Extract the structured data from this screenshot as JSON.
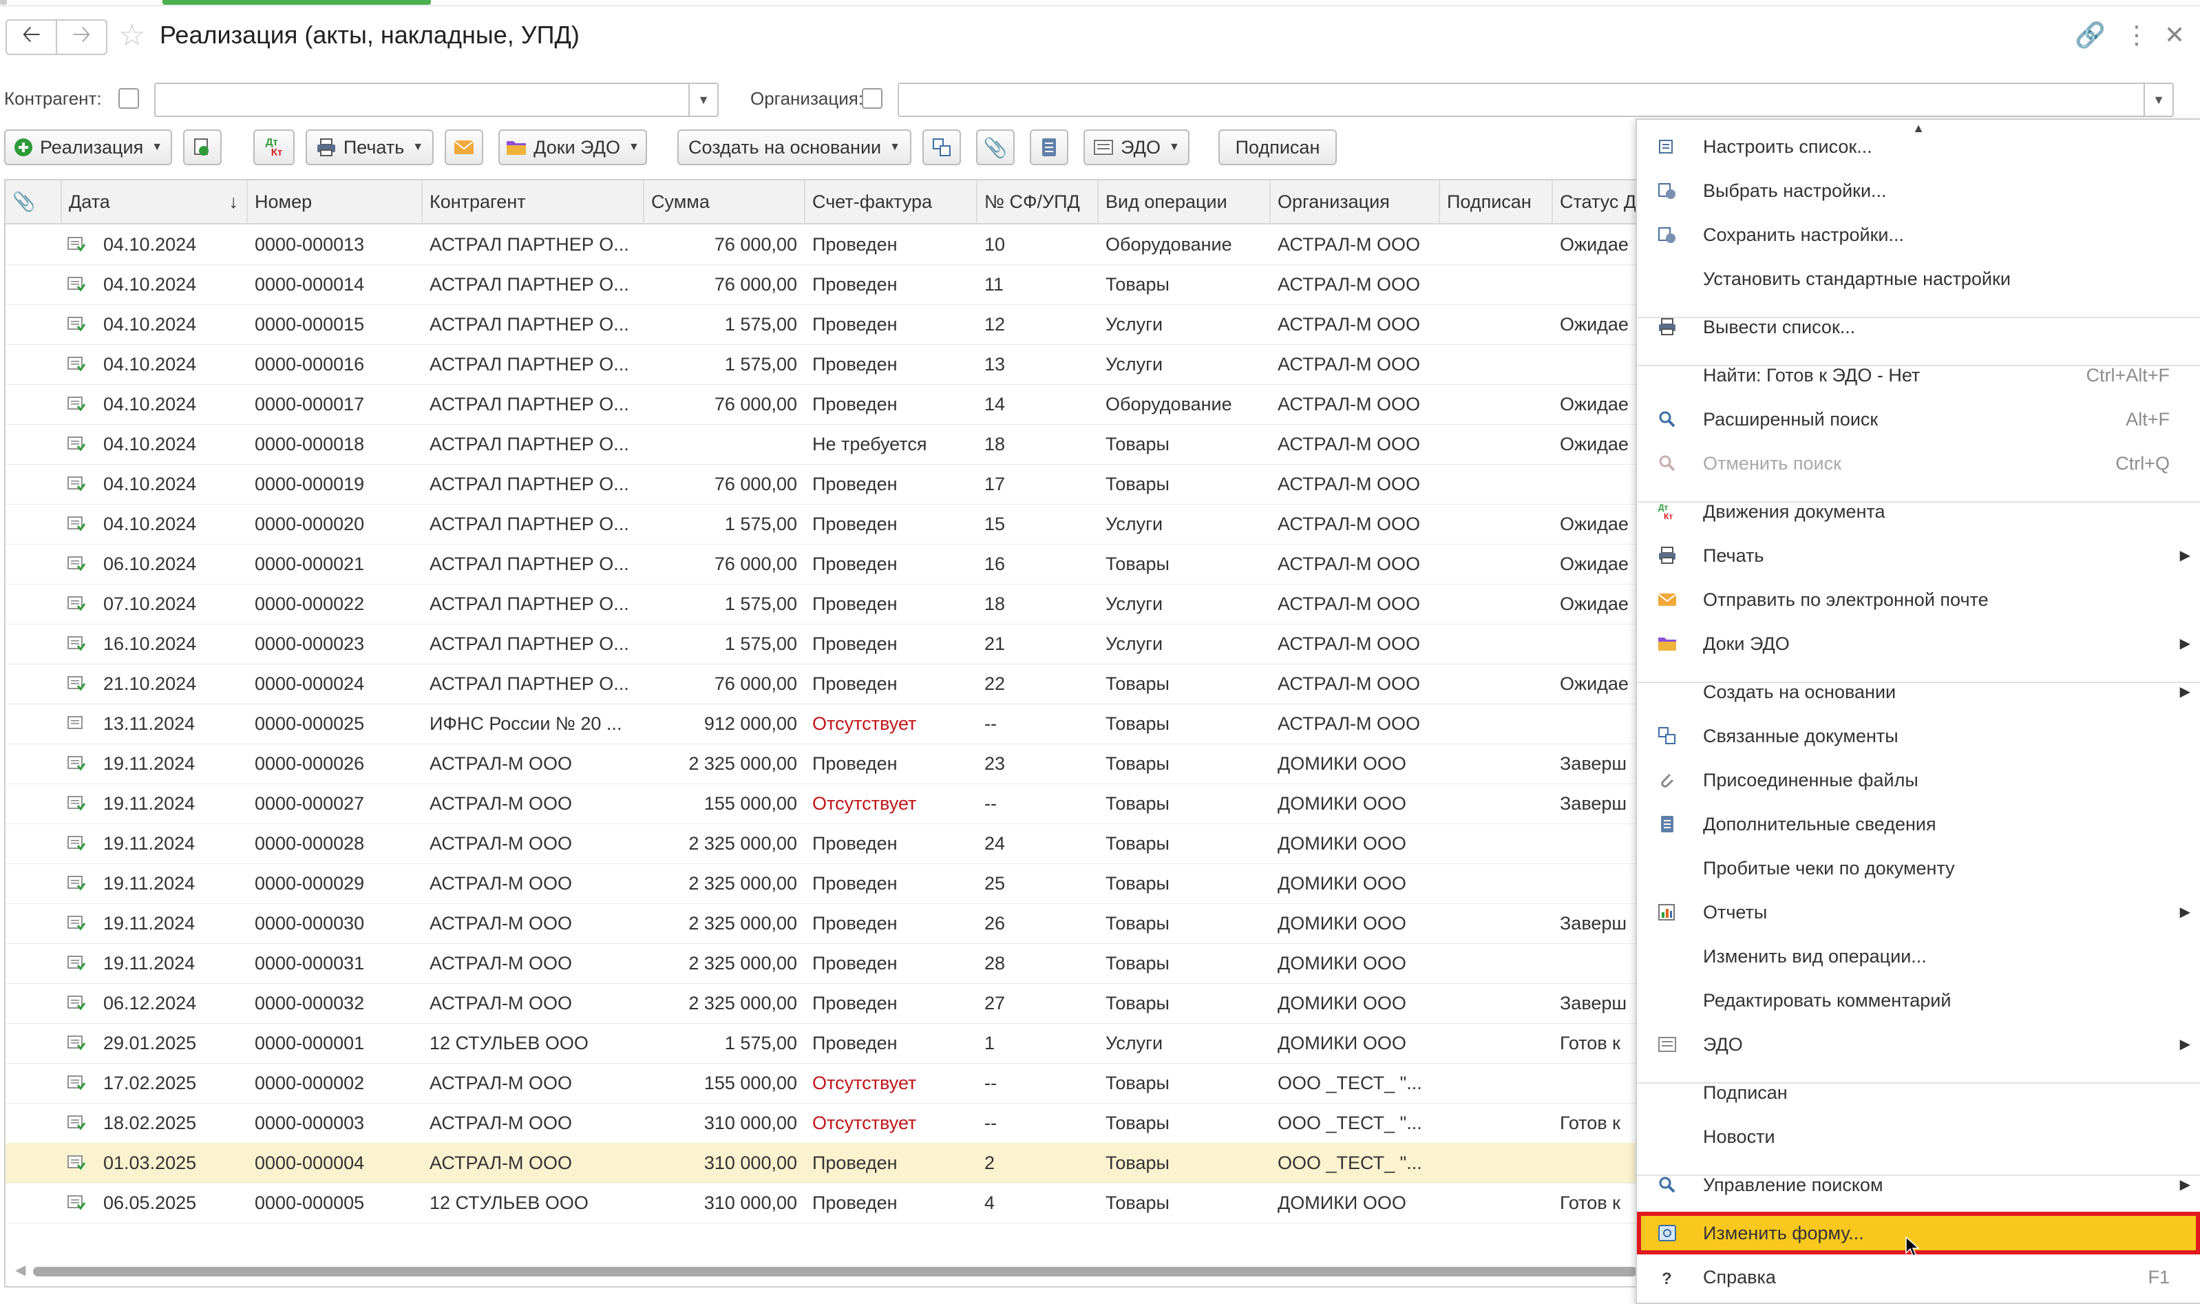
{
  "window": {
    "title": "Реализация (акты, накладные, УПД)"
  },
  "filters": {
    "counterparty_label": "Контрагент:",
    "counterparty_value": "",
    "organization_label": "Организация:",
    "organization_value": ""
  },
  "toolbar": {
    "realization": "Реализация",
    "print": "Печать",
    "edo_docs": "Доки ЭДО",
    "create_based": "Создать на основании",
    "edo": "ЭДО",
    "signed": "Подписан",
    "dtkt_top": "Дт",
    "dtkt_bottom": "Кт"
  },
  "table": {
    "columns": [
      "Дата",
      "Номер",
      "Контрагент",
      "Сумма",
      "Счет-фактура",
      "№ СФ/УПД",
      "Вид операции",
      "Организация",
      "Подписан",
      "Статус Д"
    ],
    "sort_indicator": "↓",
    "rows": [
      {
        "date": "04.10.2024",
        "number": "0000-000013",
        "counterparty": "АСТРАЛ ПАРТНЕР О...",
        "sum": "76 000,00",
        "invoice": "Проведен",
        "sf": "10",
        "operation": "Оборудование",
        "org": "АСТРАЛ-М ООО",
        "signed": "",
        "status": "Ожидае",
        "invoice_missing": false
      },
      {
        "date": "04.10.2024",
        "number": "0000-000014",
        "counterparty": "АСТРАЛ ПАРТНЕР О...",
        "sum": "76 000,00",
        "invoice": "Проведен",
        "sf": "11",
        "operation": "Товары",
        "org": "АСТРАЛ-М ООО",
        "signed": "",
        "status": "",
        "invoice_missing": false
      },
      {
        "date": "04.10.2024",
        "number": "0000-000015",
        "counterparty": "АСТРАЛ ПАРТНЕР О...",
        "sum": "1 575,00",
        "invoice": "Проведен",
        "sf": "12",
        "operation": "Услуги",
        "org": "АСТРАЛ-М ООО",
        "signed": "",
        "status": "Ожидае",
        "invoice_missing": false
      },
      {
        "date": "04.10.2024",
        "number": "0000-000016",
        "counterparty": "АСТРАЛ ПАРТНЕР О...",
        "sum": "1 575,00",
        "invoice": "Проведен",
        "sf": "13",
        "operation": "Услуги",
        "org": "АСТРАЛ-М ООО",
        "signed": "",
        "status": "",
        "invoice_missing": false
      },
      {
        "date": "04.10.2024",
        "number": "0000-000017",
        "counterparty": "АСТРАЛ ПАРТНЕР О...",
        "sum": "76 000,00",
        "invoice": "Проведен",
        "sf": "14",
        "operation": "Оборудование",
        "org": "АСТРАЛ-М ООО",
        "signed": "",
        "status": "Ожидае",
        "invoice_missing": false
      },
      {
        "date": "04.10.2024",
        "number": "0000-000018",
        "counterparty": "АСТРАЛ ПАРТНЕР О...",
        "sum": "",
        "invoice": "Не требуется",
        "sf": "18",
        "operation": "Товары",
        "org": "АСТРАЛ-М ООО",
        "signed": "",
        "status": "Ожидае",
        "invoice_missing": false
      },
      {
        "date": "04.10.2024",
        "number": "0000-000019",
        "counterparty": "АСТРАЛ ПАРТНЕР О...",
        "sum": "76 000,00",
        "invoice": "Проведен",
        "sf": "17",
        "operation": "Товары",
        "org": "АСТРАЛ-М ООО",
        "signed": "",
        "status": "",
        "invoice_missing": false
      },
      {
        "date": "04.10.2024",
        "number": "0000-000020",
        "counterparty": "АСТРАЛ ПАРТНЕР О...",
        "sum": "1 575,00",
        "invoice": "Проведен",
        "sf": "15",
        "operation": "Услуги",
        "org": "АСТРАЛ-М ООО",
        "signed": "",
        "status": "Ожидае",
        "invoice_missing": false
      },
      {
        "date": "06.10.2024",
        "number": "0000-000021",
        "counterparty": "АСТРАЛ ПАРТНЕР О...",
        "sum": "76 000,00",
        "invoice": "Проведен",
        "sf": "16",
        "operation": "Товары",
        "org": "АСТРАЛ-М ООО",
        "signed": "",
        "status": "Ожидае",
        "invoice_missing": false
      },
      {
        "date": "07.10.2024",
        "number": "0000-000022",
        "counterparty": "АСТРАЛ ПАРТНЕР О...",
        "sum": "1 575,00",
        "invoice": "Проведен",
        "sf": "18",
        "operation": "Услуги",
        "org": "АСТРАЛ-М ООО",
        "signed": "",
        "status": "Ожидае",
        "invoice_missing": false
      },
      {
        "date": "16.10.2024",
        "number": "0000-000023",
        "counterparty": "АСТРАЛ ПАРТНЕР О...",
        "sum": "1 575,00",
        "invoice": "Проведен",
        "sf": "21",
        "operation": "Услуги",
        "org": "АСТРАЛ-М ООО",
        "signed": "",
        "status": "",
        "invoice_missing": false
      },
      {
        "date": "21.10.2024",
        "number": "0000-000024",
        "counterparty": "АСТРАЛ ПАРТНЕР О...",
        "sum": "76 000,00",
        "invoice": "Проведен",
        "sf": "22",
        "operation": "Товары",
        "org": "АСТРАЛ-М ООО",
        "signed": "",
        "status": "Ожидае",
        "invoice_missing": false
      },
      {
        "date": "13.11.2024",
        "number": "0000-000025",
        "counterparty": "ИФНС России № 20 ...",
        "sum": "912 000,00",
        "invoice": "Отсутствует",
        "sf": "--",
        "operation": "Товары",
        "org": "АСТРАЛ-М ООО",
        "signed": "",
        "status": "",
        "invoice_missing": true
      },
      {
        "date": "19.11.2024",
        "number": "0000-000026",
        "counterparty": "АСТРАЛ-М ООО",
        "sum": "2 325 000,00",
        "invoice": "Проведен",
        "sf": "23",
        "operation": "Товары",
        "org": "ДОМИКИ ООО",
        "signed": "",
        "status": "Заверш",
        "invoice_missing": false
      },
      {
        "date": "19.11.2024",
        "number": "0000-000027",
        "counterparty": "АСТРАЛ-М ООО",
        "sum": "155 000,00",
        "invoice": "Отсутствует",
        "sf": "--",
        "operation": "Товары",
        "org": "ДОМИКИ ООО",
        "signed": "",
        "status": "Заверш",
        "invoice_missing": true
      },
      {
        "date": "19.11.2024",
        "number": "0000-000028",
        "counterparty": "АСТРАЛ-М ООО",
        "sum": "2 325 000,00",
        "invoice": "Проведен",
        "sf": "24",
        "operation": "Товары",
        "org": "ДОМИКИ ООО",
        "signed": "",
        "status": "",
        "invoice_missing": false
      },
      {
        "date": "19.11.2024",
        "number": "0000-000029",
        "counterparty": "АСТРАЛ-М ООО",
        "sum": "2 325 000,00",
        "invoice": "Проведен",
        "sf": "25",
        "operation": "Товары",
        "org": "ДОМИКИ ООО",
        "signed": "",
        "status": "",
        "invoice_missing": false
      },
      {
        "date": "19.11.2024",
        "number": "0000-000030",
        "counterparty": "АСТРАЛ-М ООО",
        "sum": "2 325 000,00",
        "invoice": "Проведен",
        "sf": "26",
        "operation": "Товары",
        "org": "ДОМИКИ ООО",
        "signed": "",
        "status": "Заверш",
        "invoice_missing": false
      },
      {
        "date": "19.11.2024",
        "number": "0000-000031",
        "counterparty": "АСТРАЛ-М ООО",
        "sum": "2 325 000,00",
        "invoice": "Проведен",
        "sf": "28",
        "operation": "Товары",
        "org": "ДОМИКИ ООО",
        "signed": "",
        "status": "",
        "invoice_missing": false
      },
      {
        "date": "06.12.2024",
        "number": "0000-000032",
        "counterparty": "АСТРАЛ-М ООО",
        "sum": "2 325 000,00",
        "invoice": "Проведен",
        "sf": "27",
        "operation": "Товары",
        "org": "ДОМИКИ ООО",
        "signed": "",
        "status": "Заверш",
        "invoice_missing": false
      },
      {
        "date": "29.01.2025",
        "number": "0000-000001",
        "counterparty": "12 СТУЛЬЕВ ООО",
        "sum": "1 575,00",
        "invoice": "Проведен",
        "sf": "1",
        "operation": "Услуги",
        "org": "ДОМИКИ ООО",
        "signed": "",
        "status": "Готов к",
        "invoice_missing": false
      },
      {
        "date": "17.02.2025",
        "number": "0000-000002",
        "counterparty": "АСТРАЛ-М ООО",
        "sum": "155 000,00",
        "invoice": "Отсутствует",
        "sf": "--",
        "operation": "Товары",
        "org": "ООО _ТЕСТ_ \"...",
        "signed": "",
        "status": "",
        "invoice_missing": true
      },
      {
        "date": "18.02.2025",
        "number": "0000-000003",
        "counterparty": "АСТРАЛ-М ООО",
        "sum": "310 000,00",
        "invoice": "Отсутствует",
        "sf": "--",
        "operation": "Товары",
        "org": "ООО _ТЕСТ_ \"...",
        "signed": "",
        "status": "Готов к",
        "invoice_missing": true
      },
      {
        "date": "01.03.2025",
        "number": "0000-000004",
        "counterparty": "АСТРАЛ-М ООО",
        "sum": "310 000,00",
        "invoice": "Проведен",
        "sf": "2",
        "operation": "Товары",
        "org": "ООО _ТЕСТ_ \"...",
        "signed": "",
        "status": "",
        "invoice_missing": false,
        "selected": true
      },
      {
        "date": "06.05.2025",
        "number": "0000-000005",
        "counterparty": "12 СТУЛЬЕВ ООО",
        "sum": "310 000,00",
        "invoice": "Проведен",
        "sf": "4",
        "operation": "Товары",
        "org": "ДОМИКИ ООО",
        "signed": "",
        "status": "Готов к",
        "invoice_missing": false
      }
    ]
  },
  "context_menu": {
    "items": [
      {
        "label": "Настроить список...",
        "icon": "list-settings-icon",
        "shortcut": "",
        "submenu": false
      },
      {
        "label": "Выбрать настройки...",
        "icon": "select-settings-icon",
        "shortcut": "",
        "submenu": false
      },
      {
        "label": "Сохранить настройки...",
        "icon": "save-settings-icon",
        "shortcut": "",
        "submenu": false
      },
      {
        "label": "Установить стандартные настройки",
        "icon": "",
        "shortcut": "",
        "submenu": false
      },
      {
        "label": "Вывести список...",
        "icon": "print-list-icon",
        "shortcut": "",
        "submenu": false,
        "sep_before": true
      },
      {
        "label": "Найти: Готов к ЭДО - Нет",
        "icon": "",
        "shortcut": "Ctrl+Alt+F",
        "submenu": false,
        "sep_before": true
      },
      {
        "label": "Расширенный поиск",
        "icon": "search-icon",
        "shortcut": "Alt+F",
        "submenu": false
      },
      {
        "label": "Отменить поиск",
        "icon": "cancel-search-icon",
        "shortcut": "Ctrl+Q",
        "submenu": false,
        "disabled": true
      },
      {
        "label": "Движения документа",
        "icon": "dtkt-icon",
        "shortcut": "",
        "submenu": false,
        "sep_before": true
      },
      {
        "label": "Печать",
        "icon": "printer-icon",
        "shortcut": "",
        "submenu": true
      },
      {
        "label": "Отправить по электронной почте",
        "icon": "envelope-icon",
        "shortcut": "",
        "submenu": false
      },
      {
        "label": "Доки ЭДО",
        "icon": "folder-icon",
        "shortcut": "",
        "submenu": true
      },
      {
        "label": "Создать на основании",
        "icon": "",
        "shortcut": "",
        "submenu": true,
        "sep_before": true
      },
      {
        "label": "Связанные документы",
        "icon": "related-docs-icon",
        "shortcut": "",
        "submenu": false
      },
      {
        "label": "Присоединенные файлы",
        "icon": "paperclip-icon",
        "shortcut": "",
        "submenu": false
      },
      {
        "label": "Дополнительные сведения",
        "icon": "info-list-icon",
        "shortcut": "",
        "submenu": false
      },
      {
        "label": "Пробитые чеки по документу",
        "icon": "",
        "shortcut": "",
        "submenu": false
      },
      {
        "label": "Отчеты",
        "icon": "reports-icon",
        "shortcut": "",
        "submenu": true
      },
      {
        "label": "Изменить вид операции...",
        "icon": "",
        "shortcut": "",
        "submenu": false
      },
      {
        "label": "Редактировать комментарий",
        "icon": "",
        "shortcut": "",
        "submenu": false
      },
      {
        "label": "ЭДО",
        "icon": "edo-icon",
        "shortcut": "",
        "submenu": true
      },
      {
        "label": "Подписан",
        "icon": "",
        "shortcut": "",
        "submenu": false,
        "sep_before": true
      },
      {
        "label": "Новости",
        "icon": "",
        "shortcut": "",
        "submenu": false
      },
      {
        "label": "Управление поиском",
        "icon": "search-icon",
        "shortcut": "",
        "submenu": true,
        "sep_before": true
      },
      {
        "label": "Изменить форму...",
        "icon": "change-form-icon",
        "shortcut": "",
        "submenu": false,
        "highlighted": true,
        "sep_before": true
      },
      {
        "label": "Справка",
        "icon": "help-icon",
        "shortcut": "F1",
        "submenu": false
      }
    ]
  },
  "colors": {
    "accent_green": "#4caf50",
    "menu_highlight": "#f8c81e",
    "highlight_border": "#e0191e",
    "missing_red": "#c0151a",
    "selected_row": "#fbf3cf"
  }
}
